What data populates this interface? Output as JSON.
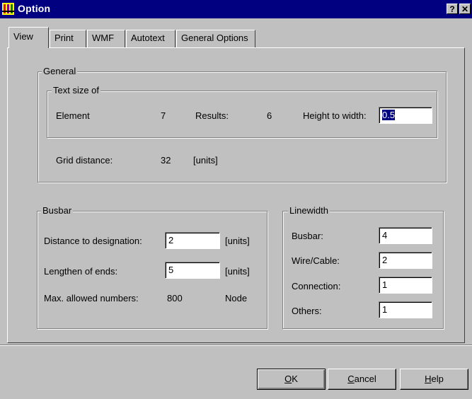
{
  "window": {
    "title": "Option",
    "help_btn": "?",
    "close_btn": "✕"
  },
  "tabs": [
    "View",
    "Print",
    "WMF",
    "Autotext",
    "General Options"
  ],
  "general": {
    "label": "General",
    "text_size": {
      "label": "Text size of",
      "element_label": "Element",
      "element_value": "7",
      "results_label": "Results:",
      "results_value": "6",
      "height_width_label": "Height to width:",
      "height_width_value": "0.5"
    },
    "grid_label": "Grid distance:",
    "grid_value": "32",
    "grid_unit": "[units]"
  },
  "busbar": {
    "label": "Busbar",
    "distance_label": "Distance to designation:",
    "distance_value": "2",
    "distance_unit": "[units]",
    "lengthen_label": "Lengthen of ends:",
    "lengthen_value": "5",
    "lengthen_unit": "[units]",
    "max_label": "Max. allowed numbers:",
    "max_value": "800",
    "max_unit": "Node"
  },
  "linewidth": {
    "label": "Linewidth",
    "busbar_label": "Busbar:",
    "busbar_value": "4",
    "wire_label": "Wire/Cable:",
    "wire_value": "2",
    "connection_label": "Connection:",
    "connection_value": "1",
    "others_label": "Others:",
    "others_value": "1"
  },
  "buttons": {
    "ok_mnemonic": "O",
    "ok_rest": "K",
    "cancel_mnemonic": "C",
    "cancel_rest": "ancel",
    "help_mnemonic": "H",
    "help_rest": "elp"
  }
}
